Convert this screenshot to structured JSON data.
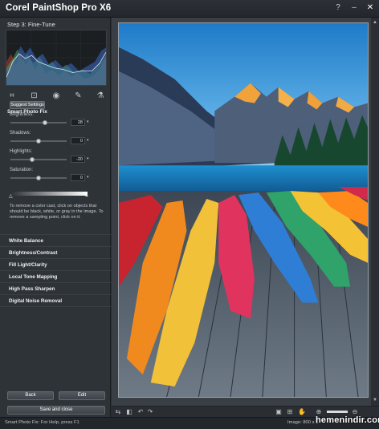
{
  "app": {
    "title": "Corel PaintShop Pro X6"
  },
  "window_controls": {
    "help": "?",
    "minimize": "–",
    "close": "✕"
  },
  "panel": {
    "step_title": "Step 3: Fine-Tune",
    "tools": [
      "crop-icon",
      "straighten-icon",
      "red-eye-icon",
      "retouch-icon",
      "color-picker-icon"
    ],
    "tool_glyphs": [
      "⌗",
      "⊡",
      "◉",
      "✎",
      "⚗"
    ],
    "section_title": "Smart Photo Fix",
    "suggest_label": "Suggest Settings",
    "sliders": [
      {
        "label": "Brightness:",
        "value": "28",
        "level": 0.62
      },
      {
        "label": "Shadows:",
        "value": "0",
        "level": 0.5
      },
      {
        "label": "Highlights:",
        "value": "-20",
        "level": 0.38
      },
      {
        "label": "Saturation:",
        "value": "0",
        "level": 0.5
      }
    ],
    "instructions": "To remove a color cast, click on objects that should be black, white, or gray in the image. To remove a sampling point, click on it.",
    "nav_items": [
      "White Balance",
      "Brightness/Contrast",
      "Fill Light/Clarity",
      "Local Tone Mapping",
      "High Pass Sharpen",
      "Digital Noise Removal"
    ],
    "back_label": "Back",
    "edit_label": "Edit",
    "save_label": "Save and close"
  },
  "status": {
    "left": "Smart Photo Fix: For Help, press F1",
    "right": "Image: 800 x 1"
  },
  "watermark": "hemenindir.com",
  "colors": {
    "accent": "#5b6168",
    "panel_bg": "#2e3338",
    "canvas_bg": "#3a3f45"
  }
}
